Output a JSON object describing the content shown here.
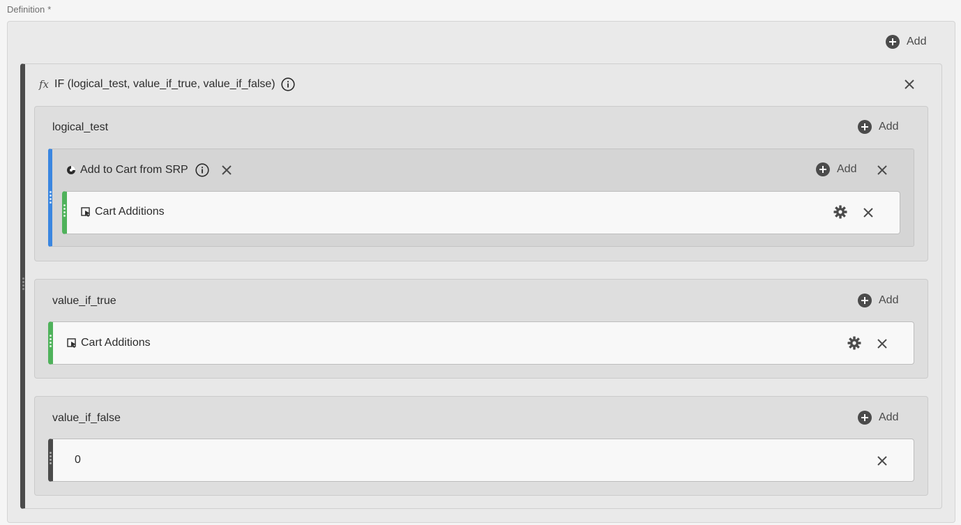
{
  "definition": {
    "label": "Definition",
    "required_mark": "*"
  },
  "top_add": {
    "label": "Add"
  },
  "function": {
    "signature": "IF (logical_test, value_if_true, value_if_false)",
    "fx_symbol": "fx"
  },
  "groups": [
    {
      "title": "logical_test",
      "add_label": "Add",
      "segment": {
        "title": "Add to Cart from SRP",
        "add_label": "Add",
        "metric": {
          "label": "Cart Additions"
        }
      }
    },
    {
      "title": "value_if_true",
      "add_label": "Add",
      "metric": {
        "label": "Cart Additions"
      }
    },
    {
      "title": "value_if_false",
      "add_label": "Add",
      "static_value": "0"
    }
  ],
  "colors": {
    "segment_accent": "#3a86e0",
    "metric_accent": "#4fb25b",
    "function_accent": "#4b4b4b"
  },
  "icons": {
    "add": "plus-circle-icon",
    "close": "close-icon",
    "info": "info-icon",
    "settings": "gear-icon",
    "segment": "segment-icon",
    "metric": "metric-icon",
    "drag": "drag-handle-icon"
  }
}
